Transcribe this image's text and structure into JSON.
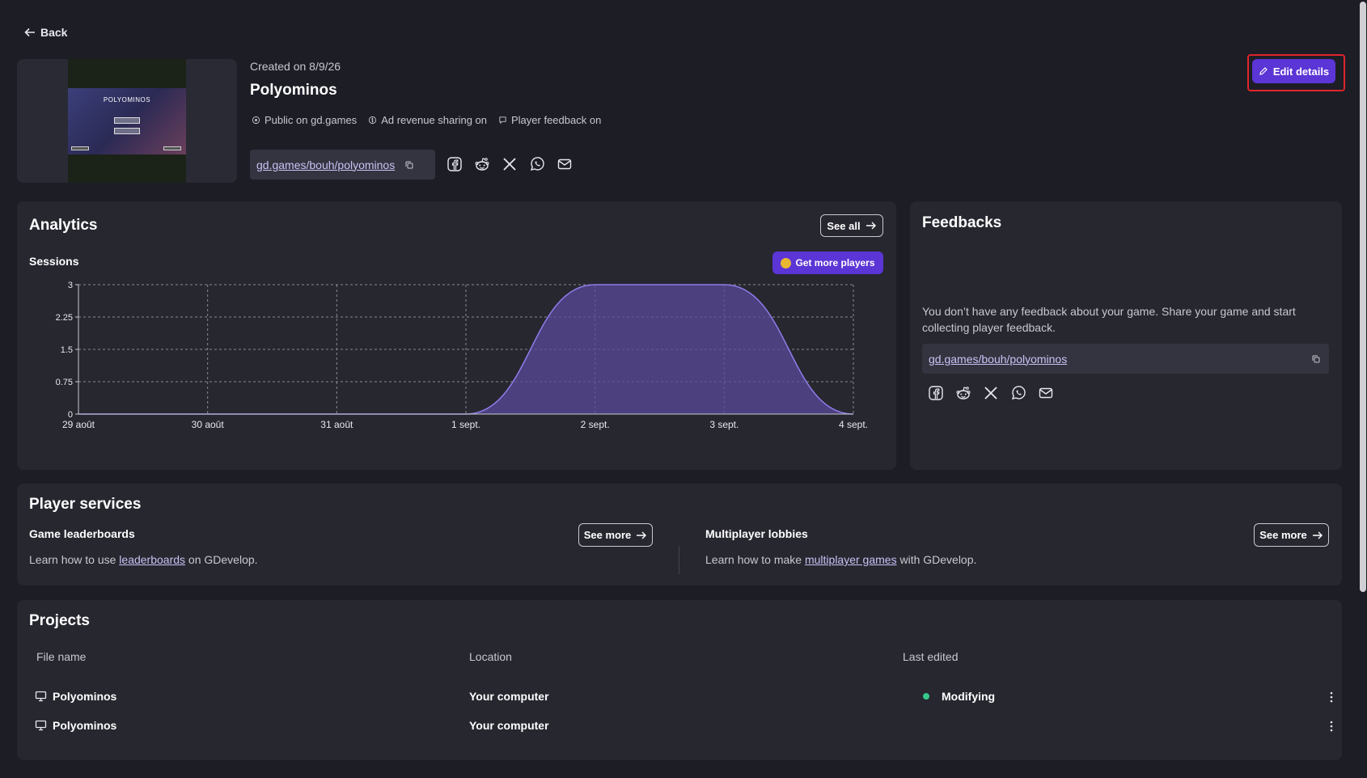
{
  "nav": {
    "back_label": "Back"
  },
  "game": {
    "created": "Created on 8/9/26",
    "title": "Polyominos",
    "thumbnail_title": "POLYOMINOS",
    "flags": [
      "Public on gd.games",
      "Ad revenue sharing on",
      "Player feedback on"
    ],
    "link": "gd.games/bouh/polyominos",
    "edit_label": "Edit details"
  },
  "share_icons": [
    "facebook-icon",
    "reddit-icon",
    "x-icon",
    "whatsapp-icon",
    "mail-icon"
  ],
  "analytics": {
    "title": "Analytics",
    "see_all": "See all",
    "sessions_label": "Sessions",
    "get_more_players": "Get more players"
  },
  "chart_data": {
    "type": "area",
    "title": "Sessions",
    "x": [
      "29 août",
      "30 août",
      "31 août",
      "1 sept.",
      "2 sept.",
      "3 sept.",
      "4 sept."
    ],
    "series": [
      {
        "values": [
          0,
          0,
          0,
          0,
          3,
          3,
          0
        ]
      }
    ],
    "yticks": [
      "0",
      "0.75",
      "1.5",
      "2.25",
      "3"
    ],
    "ylim": [
      0,
      3
    ],
    "grid": true,
    "colors": {
      "fill": "#5a4a9a",
      "line": "#8f7ce8"
    }
  },
  "feedbacks": {
    "title": "Feedbacks",
    "text": "You don’t have any feedback about your game. Share your game and start collecting player feedback.",
    "link": "gd.games/bouh/polyominos"
  },
  "services": {
    "title": "Player services",
    "leaderboards": {
      "title": "Game leaderboards",
      "pre": "Learn how to use ",
      "link": "leaderboards",
      "post": " on GDevelop.",
      "button": "See more"
    },
    "lobbies": {
      "title": "Multiplayer lobbies",
      "pre": "Learn how to make ",
      "link": "multiplayer games",
      "post": " with GDevelop.",
      "button": "See more"
    }
  },
  "projects": {
    "title": "Projects",
    "headers": [
      "File name",
      "Location",
      "Last edited"
    ],
    "rows": [
      {
        "name": "Polyominos",
        "location": "Your computer",
        "status": "Modifying"
      },
      {
        "name": "Polyominos",
        "location": "Your computer",
        "status": ""
      }
    ]
  },
  "colors": {
    "accent": "#5b35d5",
    "highlight": "#e0242b",
    "status_green": "#38c78a"
  }
}
